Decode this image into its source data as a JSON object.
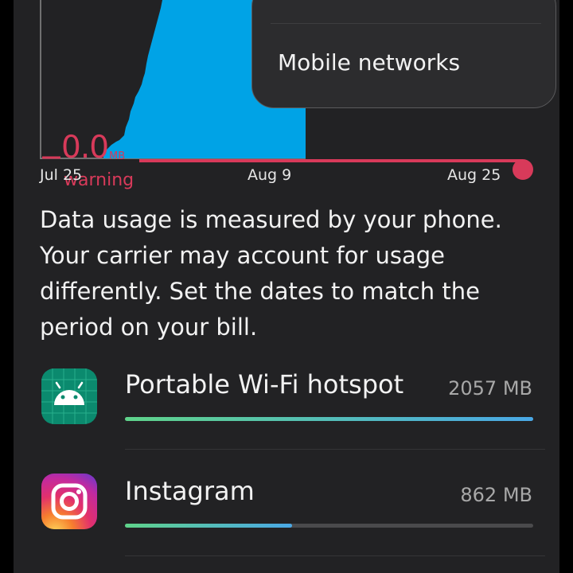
{
  "chart": {
    "dates": [
      "Jul 25",
      "Aug 9",
      "Aug 25"
    ],
    "warning_value": "0.0",
    "warning_unit": "MB",
    "warning_label": "warning",
    "bar_color": "#00a3e6",
    "limit_color": "#d83a5a"
  },
  "popup": {
    "item": "Mobile networks"
  },
  "info": {
    "text": "Data usage is measured by your phone. Your carrier may account for usage differently. Set the dates to match the period on your bill."
  },
  "apps": [
    {
      "name": "Portable Wi-Fi hotspot",
      "size": "2057 MB",
      "usage_fraction": 1.0,
      "icon": "android-icon"
    },
    {
      "name": "Instagram",
      "size": "862 MB",
      "usage_fraction": 0.41,
      "icon": "instagram-icon"
    }
  ]
}
